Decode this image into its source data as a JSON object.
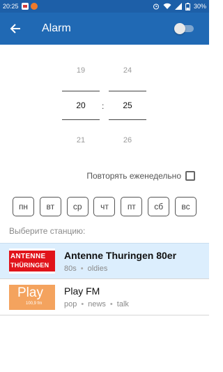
{
  "status_bar": {
    "time": "20:25",
    "battery": "30%",
    "icons": [
      "notification-icon",
      "notification-icon",
      "alarm-clock-icon",
      "wifi-icon",
      "signal-icon",
      "battery-icon"
    ]
  },
  "app_bar": {
    "back_icon": "arrow-back-icon",
    "title": "Alarm",
    "toggle_on": false
  },
  "time_picker": {
    "hours": {
      "prev": "19",
      "current": "20",
      "next": "21"
    },
    "minutes": {
      "prev": "24",
      "current": "25",
      "next": "26"
    },
    "separator": ":"
  },
  "repeat": {
    "label": "Повторять еженедельно",
    "checked": false
  },
  "days": [
    "пн",
    "вт",
    "ср",
    "чт",
    "пт",
    "сб",
    "вс"
  ],
  "station_prompt": "Выберите станцию:",
  "stations": [
    {
      "logo_line1": "ANTENNE",
      "logo_line2": "THÜRINGEN",
      "name": "Antenne Thuringen 80er",
      "tags": [
        "80s",
        "oldies"
      ],
      "selected": true
    },
    {
      "logo_line1": "Play",
      "logo_line2": "100,9 fm",
      "name": "Play FM",
      "tags": [
        "pop",
        "news",
        "talk"
      ],
      "selected": false
    }
  ],
  "colors": {
    "primary": "#2069b4",
    "status_bar": "#1d5fa8",
    "selected_row": "#dceefd",
    "antenne_red": "#e1131a",
    "play_orange": "#f4a35e"
  }
}
